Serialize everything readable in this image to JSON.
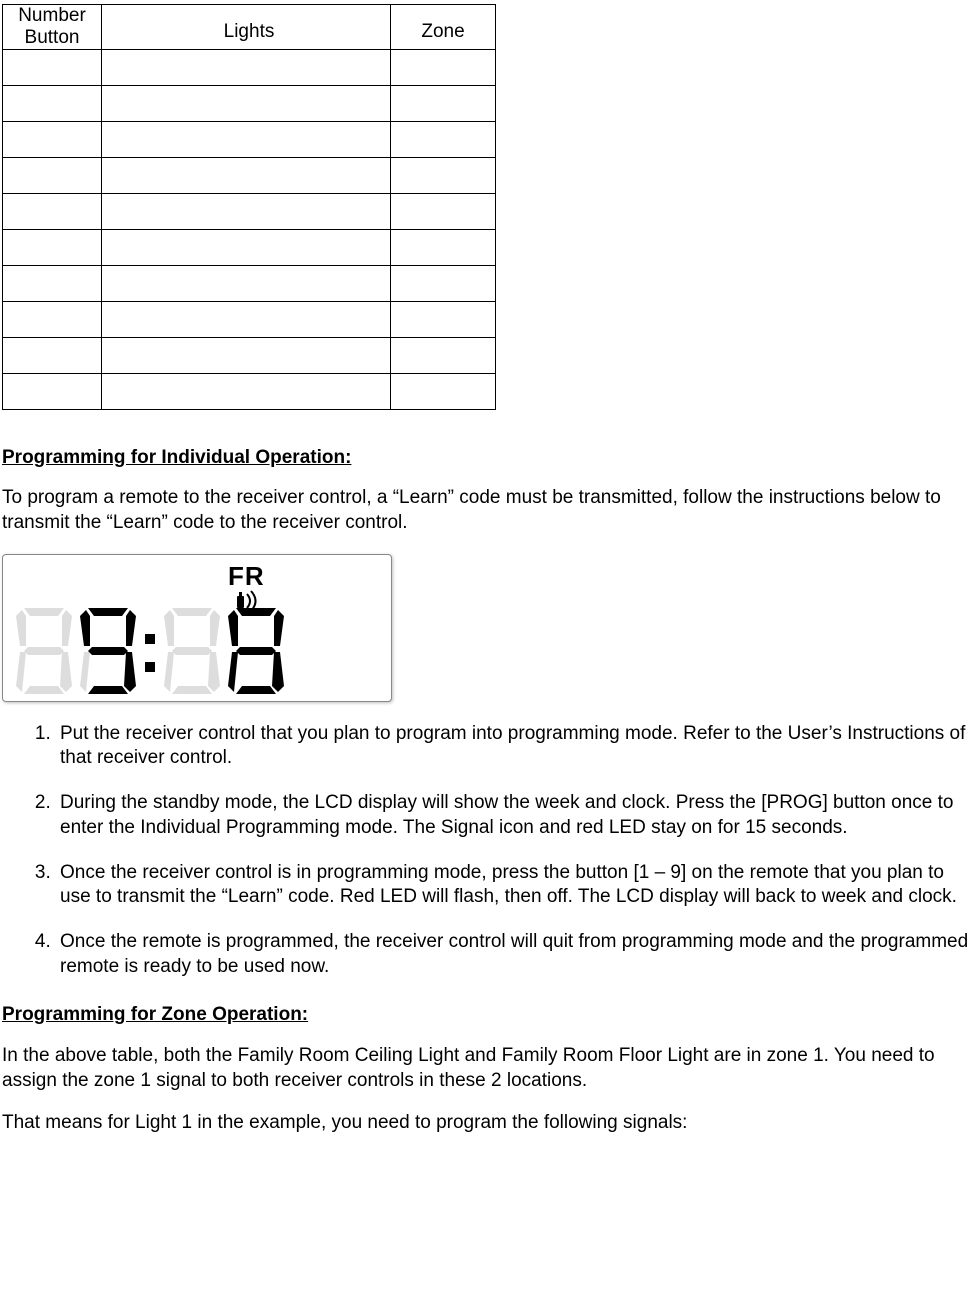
{
  "table": {
    "headers": {
      "num": "Number\nButton",
      "lights": "Lights",
      "zone": "Zone"
    },
    "rows": 10
  },
  "section1": {
    "title": "Programming for Individual Operation:",
    "intro": "To program a remote to the receiver control, a \"Learn\" code must be transmitted, follow the instructions below to transmit the \"Learn\" code to the receiver control.",
    "steps": [
      "Put the receiver control that you plan to program into programming mode. Refer to the User's Instructions of that receiver control.",
      "During the standby mode, the LCD display will show the week and clock. Press the [PROG] button once to enter the Individual Programming mode. The Signal icon and red LED stay on for 15 seconds.",
      "Once the receiver control is in programming mode, press the button [1 – 9] on the remote that you plan to use to transmit the \"Learn\" code. Red LED will flash, then off. The LCD display will back to week and clock.",
      "Once the remote is programmed, the receiver control will quit from programming mode and the programmed remote is ready to be used now."
    ]
  },
  "lcd": {
    "label": "FR"
  },
  "section2": {
    "title": "Programming for Zone Operation:",
    "p1": "In the above table, both the Family Room Ceiling Light and Family Room Floor Light are in zone 1. You need to assign the zone 1 signal to both receiver controls in these 2 locations.",
    "p2": "That means for Light 1 in the example, you need to program the following signals:"
  }
}
